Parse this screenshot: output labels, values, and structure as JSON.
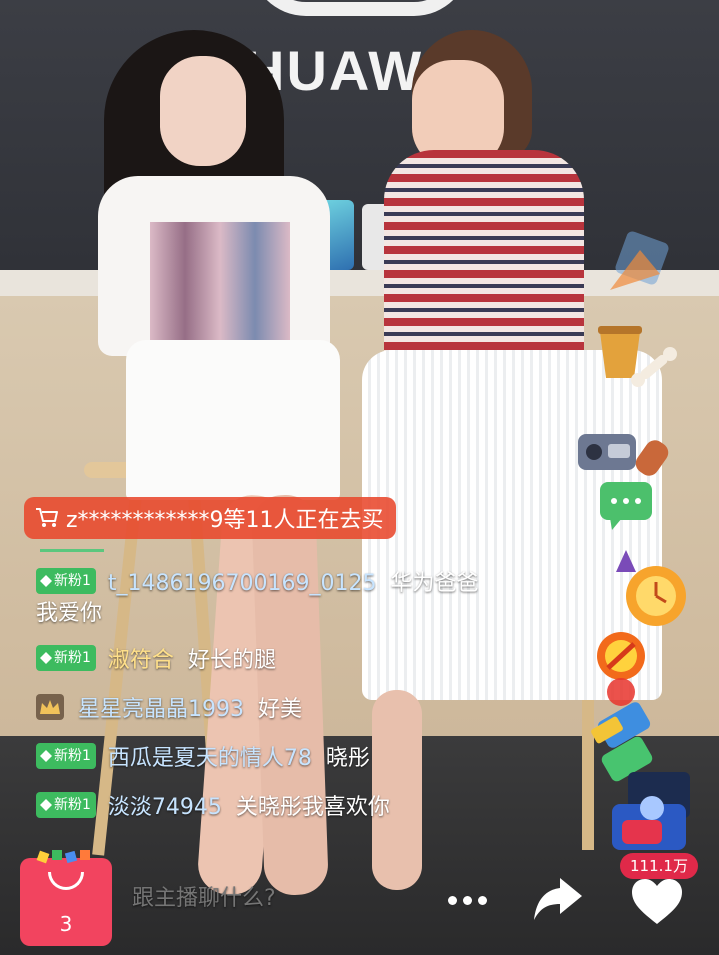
{
  "scene": {
    "brand": "HUAWEI"
  },
  "purchase_banner": {
    "icon": "cart-icon",
    "text": "z************9等11人正在去买"
  },
  "chat": {
    "messages": [
      {
        "badge": "新粉1",
        "badge_type": "new-fan",
        "user": "t_1486196700169_0125",
        "text": "华为爸爸我爱你",
        "user_color": "#c7e4ff"
      },
      {
        "badge": "新粉1",
        "badge_type": "new-fan",
        "user": "淑符合",
        "text": "好长的腿",
        "user_color": "#ffe08a"
      },
      {
        "badge": "",
        "badge_type": "crown",
        "user": "星星亮晶晶1993",
        "text": "好美",
        "user_color": "#c7e4ff"
      },
      {
        "badge": "新粉1",
        "badge_type": "new-fan",
        "user": "西瓜是夏天的情人78",
        "text": "晓彤",
        "user_color": "#c7e4ff"
      },
      {
        "badge": "新粉1",
        "badge_type": "new-fan",
        "user": "淡淡74945",
        "text": "关晓彤我喜欢你",
        "user_color": "#c7e4ff"
      }
    ]
  },
  "bottom_bar": {
    "shop_count": "3",
    "chat_placeholder": "跟主播聊什么?",
    "like_count": "111.1万"
  },
  "colors": {
    "banner": "#e8482c",
    "new_fan_badge": "#3dbb5f",
    "shop_button": "#f2445f",
    "like_badge": "#e02949"
  }
}
